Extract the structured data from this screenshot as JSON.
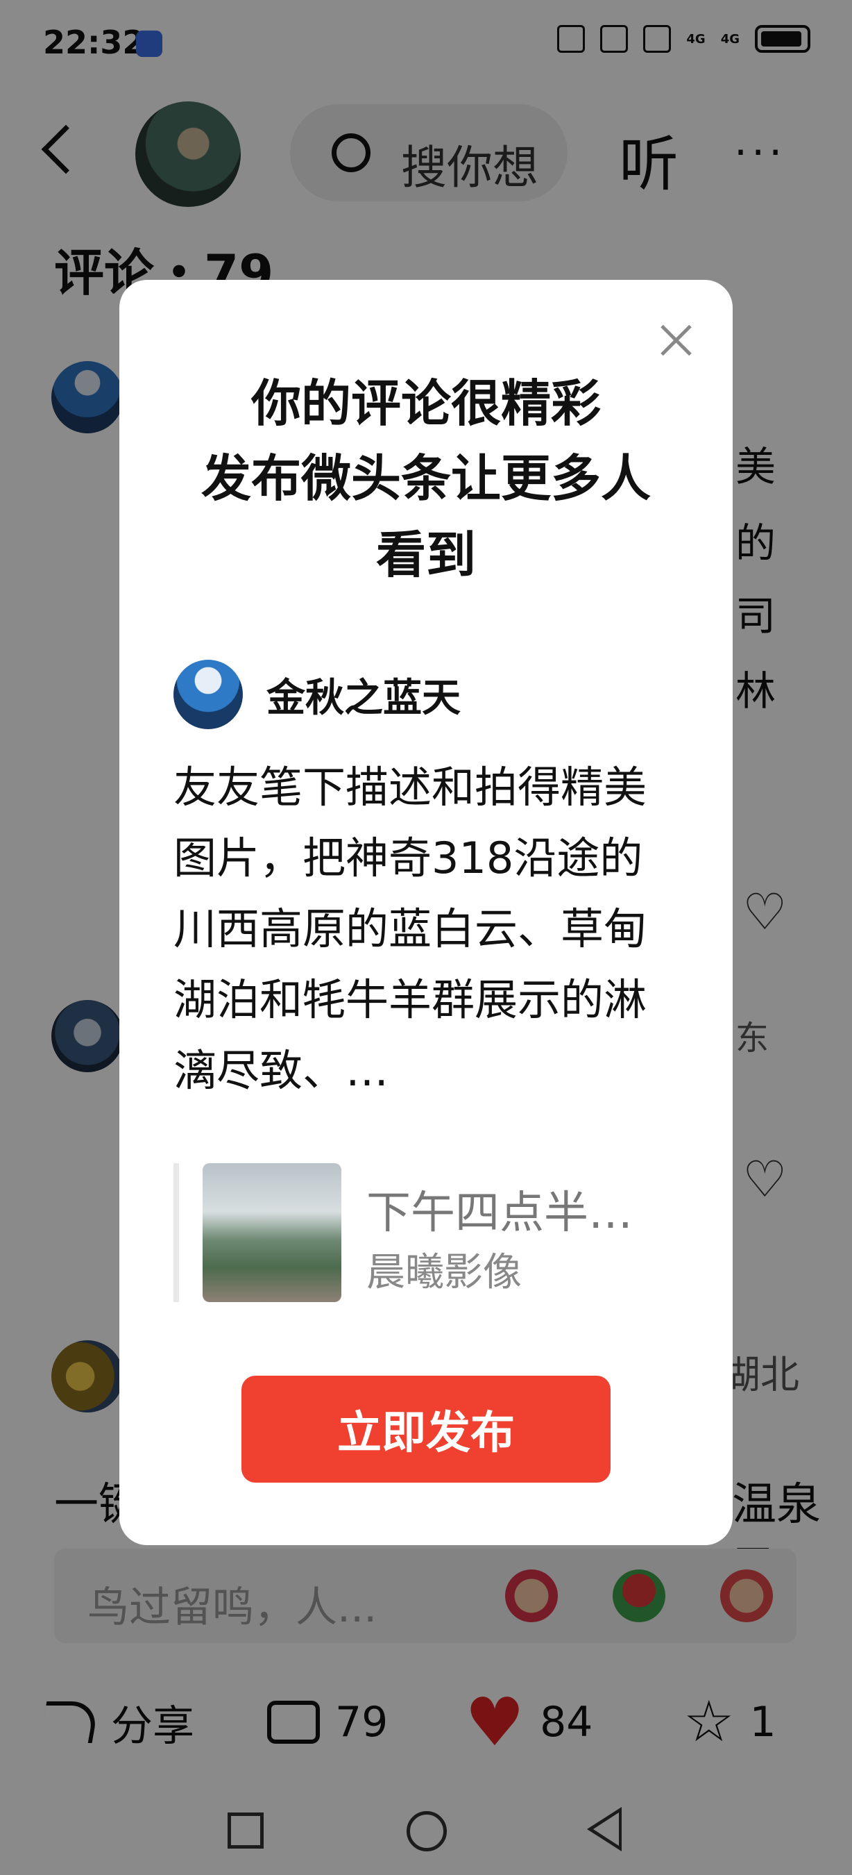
{
  "status_bar": {
    "time": "22:32",
    "network_1": "4G",
    "network_2": "4G"
  },
  "header": {
    "search_placeholder": "搜你想",
    "listen_label": "听",
    "more_label": "···"
  },
  "comments": {
    "title": "评论・79",
    "bg_fragments": [
      "美",
      "的",
      "司",
      "林",
      "东",
      "湖北",
      "一键",
      "温泉民"
    ],
    "input_placeholder": "鸟过留鸣，人..."
  },
  "bottom_bar": {
    "share_label": "分享",
    "comment_count": "79",
    "like_count": "84",
    "favorite_count": "1"
  },
  "modal": {
    "title_line1": "你的评论很精彩",
    "title_line2": "发布微头条让更多人",
    "title_line3": "看到",
    "username": "金秋之蓝天",
    "comment_text": "友友笔下描述和拍得精美图片，把神奇318沿途的川西高原的蓝白云、草甸湖泊和牦牛羊群展示的淋漓尽致、…",
    "quote_title": "下午四点半…",
    "quote_source": "晨曦影像",
    "publish_label": "立即发布"
  },
  "icons": {
    "back": "back-arrow-icon",
    "search": "search-icon",
    "close": "close-icon",
    "share": "share-icon",
    "comment": "comment-icon",
    "like": "heart-icon",
    "favorite": "star-icon"
  },
  "colors": {
    "accent": "#f0402f",
    "like_heart": "#e02424",
    "overlay": "rgba(0,0,0,0.46)"
  }
}
